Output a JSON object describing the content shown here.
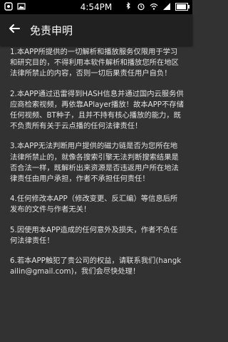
{
  "status_bar": {
    "time": "4:54PM",
    "left_icons": [
      "notification-icon",
      "image-icon"
    ],
    "right_icons": [
      "bluetooth-icon",
      "alarm-icon",
      "wifi-icon",
      "signal-icon",
      "battery-icon"
    ]
  },
  "app_bar": {
    "back_icon": "back-arrow-icon",
    "title": "免责申明"
  },
  "paragraphs": [
    "1.本APP所提供的一切解析和播放服务仅限用于学习和研究目的，不得利用本软件解析和播放您所在地区法律所禁止的内容，否则一切后果责任用户自负！",
    "2.本APP通过迅雷得到HASH信息并通过国内云服务供应商检索视频，再依靠APlayer播放！故本APP不存储任何视频、BT种子，且并不持有核心播放的能力，既不负责所有关于云点播的任何法律责任！",
    "3.本APP无法判断用户提供的磁力链是否为您所在地法律所禁止的，就像各搜索引擎无法判断搜索结果是否合法一样，既解析出来资源是否违返用户所在地法律责任由用户承担，作者不承担任何责任！",
    "4.任何修改本APP（修改变更、反汇编）等信息后所发布的文件与作者无关！",
    "5.因使用本APP造成的任何意外及损失，作者不负任何法律责任！",
    "6.若本APP触犯了贵公司的权益，请联系我们(hangkailin@gmail.com)，我们会尽快处理！"
  ]
}
